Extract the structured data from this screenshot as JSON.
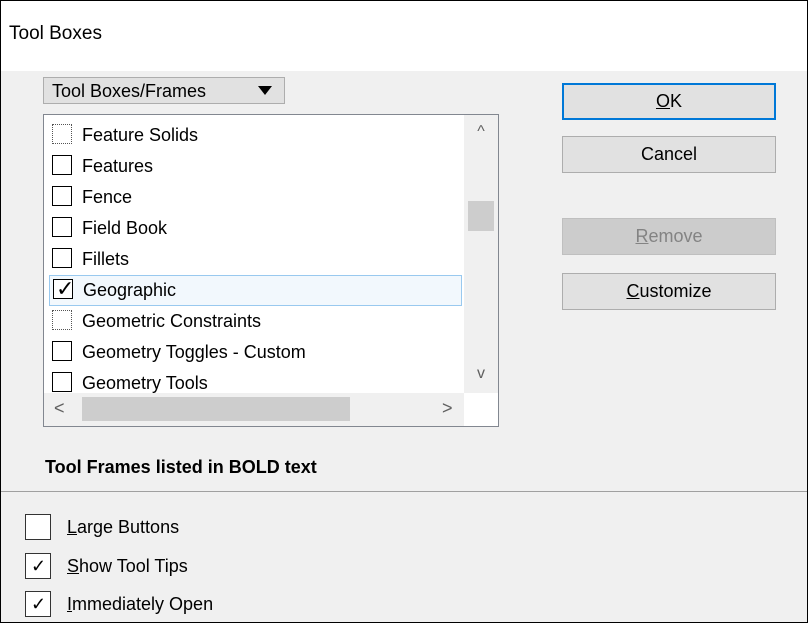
{
  "window": {
    "title": "Tool Boxes"
  },
  "dropdown": {
    "label": "Tool Boxes/Frames"
  },
  "list": {
    "items": [
      {
        "label": "Feature Solids",
        "checked": false
      },
      {
        "label": "Features",
        "checked": false
      },
      {
        "label": "Fence",
        "checked": false
      },
      {
        "label": "Field Book",
        "checked": false
      },
      {
        "label": "Fillets",
        "checked": false
      },
      {
        "label": "Geographic",
        "checked": true,
        "selected": true
      },
      {
        "label": "Geometric Constraints",
        "checked": false
      },
      {
        "label": "Geometry Toggles - Custom",
        "checked": false
      },
      {
        "label": "Geometry Tools",
        "checked": false
      }
    ],
    "scroll_up": "^",
    "scroll_down": "v",
    "scroll_left": "<",
    "scroll_right": ">"
  },
  "buttons": {
    "ok": {
      "mnemonic": "O",
      "rest": "K"
    },
    "cancel": {
      "label": "Cancel"
    },
    "remove": {
      "mnemonic": "R",
      "rest": "emove",
      "disabled": true
    },
    "customize": {
      "mnemonic": "C",
      "rest": "ustomize"
    }
  },
  "info_text": "Tool Frames listed in BOLD text",
  "options": [
    {
      "mnemonic": "L",
      "rest": "arge Buttons",
      "checked": false
    },
    {
      "mnemonic": "S",
      "rest": "how Tool Tips",
      "checked": true
    },
    {
      "mnemonic": "I",
      "rest": "mmediately Open",
      "checked": true
    }
  ],
  "glyphs": {
    "check": "✓"
  }
}
